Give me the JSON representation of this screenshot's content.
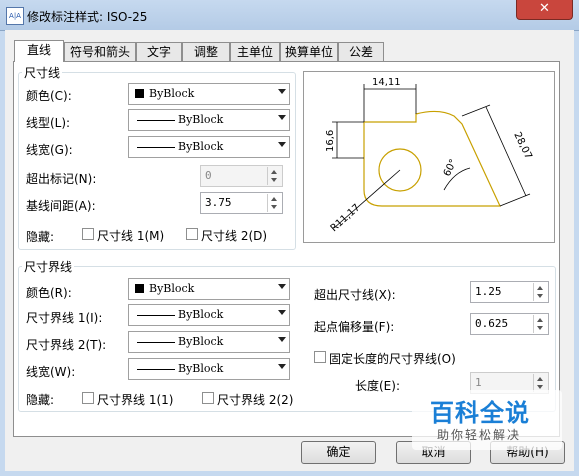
{
  "window": {
    "title": "修改标注样式: ISO-25",
    "icon_text": "A̲",
    "close_glyph": "✕"
  },
  "tabs": [
    {
      "label": "直线",
      "active": true
    },
    {
      "label": "符号和箭头"
    },
    {
      "label": "文字"
    },
    {
      "label": "调整"
    },
    {
      "label": "主单位"
    },
    {
      "label": "换算单位"
    },
    {
      "label": "公差"
    }
  ],
  "dim_lines": {
    "title": "尺寸线",
    "color_label": "颜色(C):",
    "color_value": "ByBlock",
    "linetype_label": "线型(L):",
    "linetype_value": "ByBlock",
    "lineweight_label": "线宽(G):",
    "lineweight_value": "ByBlock",
    "extend_ticks_label": "超出标记(N):",
    "extend_ticks_value": "0",
    "baseline_spacing_label": "基线间距(A):",
    "baseline_spacing_value": "3.75",
    "suppress_label": "隐藏:",
    "suppress_1": "尺寸线 1(M)",
    "suppress_2": "尺寸线 2(D)"
  },
  "ext_lines": {
    "title": "尺寸界线",
    "color_label": "颜色(R):",
    "color_value": "ByBlock",
    "linetype1_label": "尺寸界线 1(I):",
    "linetype1_value": "ByBlock",
    "linetype2_label": "尺寸界线 2(T):",
    "linetype2_value": "ByBlock",
    "lineweight_label": "线宽(W):",
    "lineweight_value": "ByBlock",
    "suppress_label": "隐藏:",
    "suppress_1": "尺寸界线 1(1)",
    "suppress_2": "尺寸界线 2(2)",
    "extend_label": "超出尺寸线(X):",
    "extend_value": "1.25",
    "offset_label": "起点偏移量(F):",
    "offset_value": "0.625",
    "fixed_label": "固定长度的尺寸界线(O)",
    "length_label": "长度(E):",
    "length_value": "1"
  },
  "preview": {
    "dim_top": "14,11",
    "dim_left": "16,6",
    "dim_right": "28,07",
    "dim_angle": "60°",
    "dim_radius": "R11,17",
    "shape_color": "#c8a000"
  },
  "buttons": {
    "ok": "确定",
    "cancel": "取消",
    "help": "帮助(H)"
  },
  "watermark": {
    "main": "百科全说",
    "sub": "助你轻松解决"
  }
}
